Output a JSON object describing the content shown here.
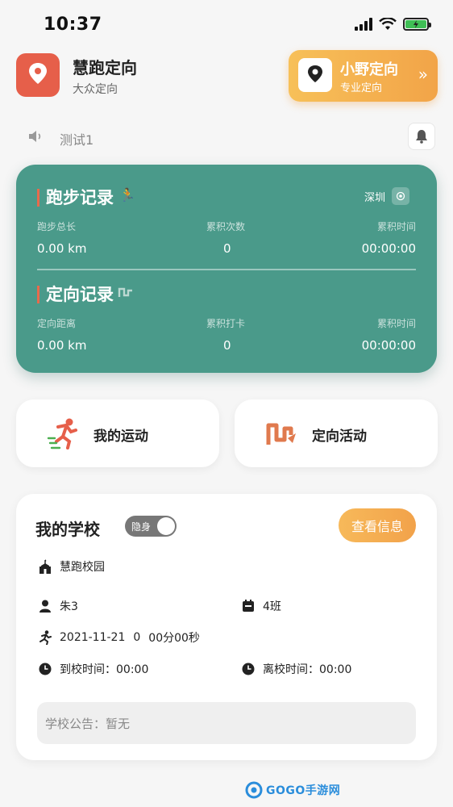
{
  "status_bar": {
    "time": "10:37"
  },
  "header": {
    "app_name": "慧跑定向",
    "app_subtitle": "大众定向",
    "promo": {
      "title": "小野定向",
      "subtitle": "专业定向",
      "arrow": "»"
    }
  },
  "notice": {
    "text": "测试1"
  },
  "stats": {
    "city": "深圳",
    "run": {
      "title": "跑步记录",
      "labels": [
        "跑步总长",
        "累积次数",
        "累积时间"
      ],
      "values": [
        "0.00 km",
        "0",
        "00:00:00"
      ]
    },
    "orienteering": {
      "title": "定向记录",
      "labels": [
        "定向距离",
        "累积打卡",
        "累积时间"
      ],
      "values": [
        "0.00 km",
        "0",
        "00:00:00"
      ]
    }
  },
  "actions": {
    "my_sport": "我的运动",
    "orienteering_activity": "定向活动"
  },
  "school": {
    "title": "我的学校",
    "toggle_label": "隐身",
    "view_info": "查看信息",
    "campus": "慧跑校园",
    "student_name": "朱3",
    "class_name": "4班",
    "run_date": "2021-11-21",
    "run_count": "0",
    "run_duration": "00分00秒",
    "arrive_time": "到校时间：00:00",
    "leave_time": "离校时间：00:00",
    "announcement": "学校公告：暂无"
  },
  "watermark": "GOGO手游网",
  "colors": {
    "teal": "#4a9a8a",
    "orange": "#f2a448",
    "red": "#e65f4a"
  }
}
